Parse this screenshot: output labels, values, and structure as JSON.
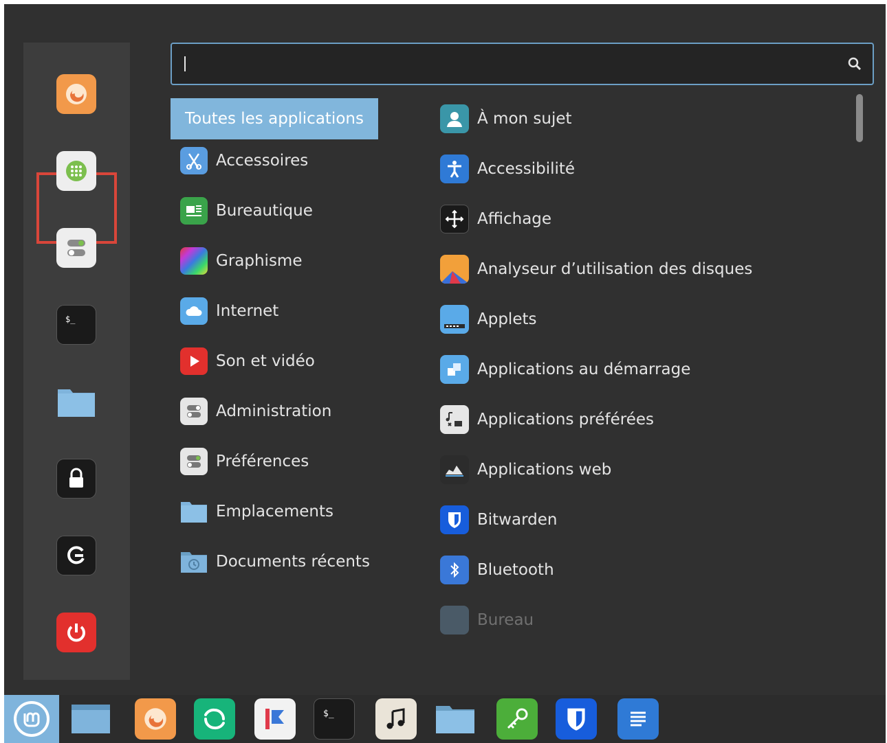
{
  "search": {
    "value": "",
    "placeholder": ""
  },
  "favorites": [
    {
      "name": "firefox-icon"
    },
    {
      "name": "software-manager-icon"
    },
    {
      "name": "settings-toggle-icon"
    },
    {
      "name": "terminal-icon"
    },
    {
      "name": "folder-icon"
    },
    {
      "name": "lock-screen-icon"
    },
    {
      "name": "logout-icon"
    },
    {
      "name": "power-icon"
    }
  ],
  "categories": [
    {
      "label": "Toutes les applications"
    },
    {
      "label": "Accessoires"
    },
    {
      "label": "Bureautique"
    },
    {
      "label": "Graphisme"
    },
    {
      "label": "Internet"
    },
    {
      "label": "Son et vidéo"
    },
    {
      "label": "Administration"
    },
    {
      "label": "Préférences"
    },
    {
      "label": "Emplacements"
    },
    {
      "label": "Documents récents"
    }
  ],
  "apps": [
    {
      "label": "À mon sujet"
    },
    {
      "label": "Accessibilité"
    },
    {
      "label": "Affichage"
    },
    {
      "label": "Analyseur d’utilisation des disques"
    },
    {
      "label": "Applets"
    },
    {
      "label": "Applications au démarrage"
    },
    {
      "label": "Applications préférées"
    },
    {
      "label": "Applications web"
    },
    {
      "label": "Bitwarden"
    },
    {
      "label": "Bluetooth"
    },
    {
      "label": "Bureau"
    }
  ],
  "taskbar": [
    {
      "name": "mint-menu-icon"
    },
    {
      "name": "show-desktop-icon"
    },
    {
      "name": "firefox-icon"
    },
    {
      "name": "element-icon"
    },
    {
      "name": "flowblade-icon"
    },
    {
      "name": "terminal-icon"
    },
    {
      "name": "music-player-icon"
    },
    {
      "name": "files-icon"
    },
    {
      "name": "passwords-keys-icon"
    },
    {
      "name": "bitwarden-icon"
    },
    {
      "name": "text-editor-icon"
    }
  ],
  "colors": {
    "accent": "#81b6dc",
    "highlight_box": "#d9463a",
    "panel_bg": "#303030"
  }
}
